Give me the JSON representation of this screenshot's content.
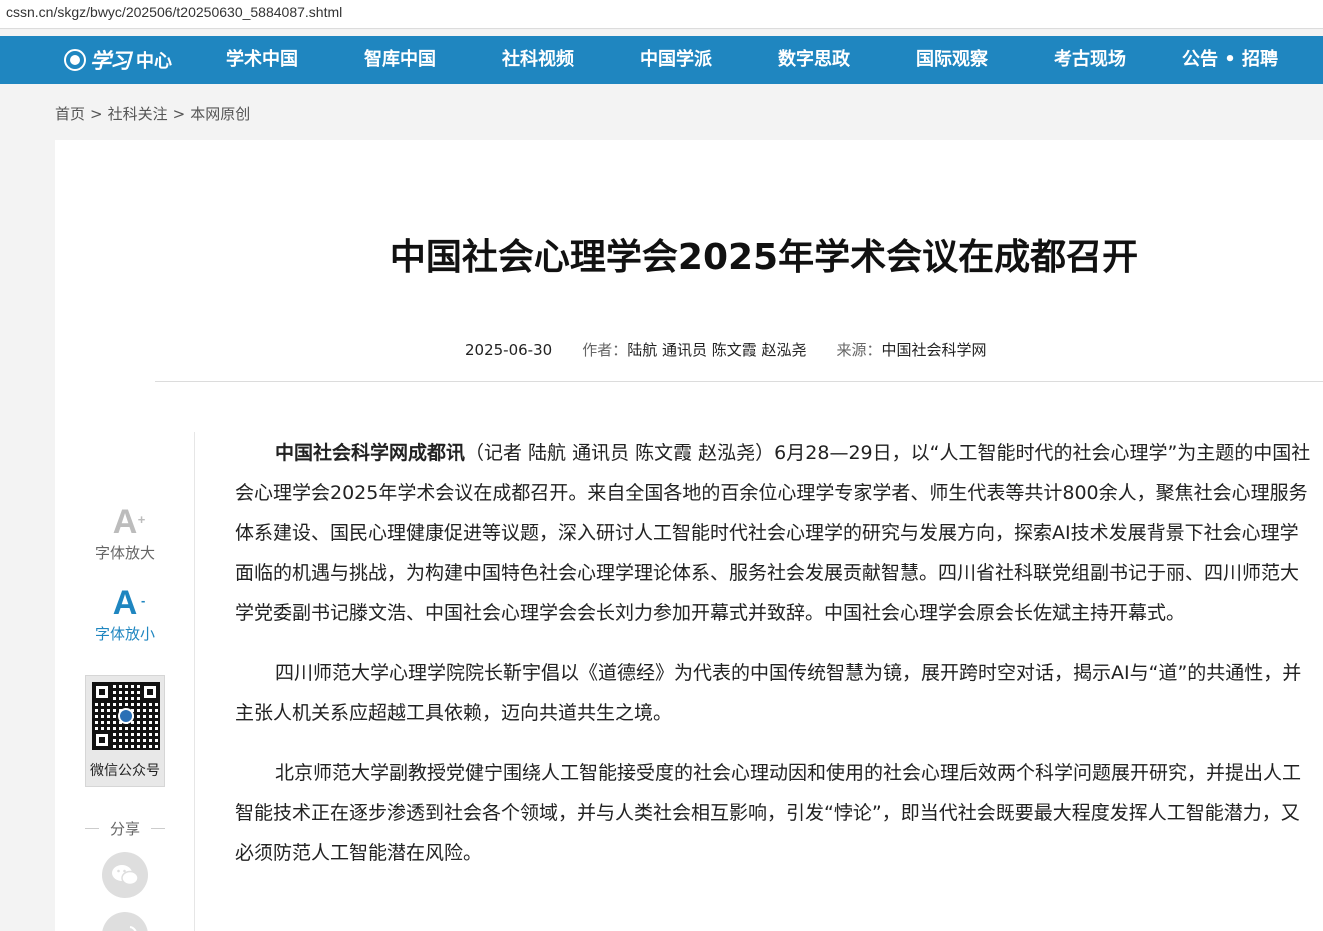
{
  "browser": {
    "url": "cssn.cn/skgz/bwyc/202506/t20250630_5884087.shtml"
  },
  "nav": {
    "logo_script": "学习",
    "logo_center": "中心",
    "items": [
      "学术中国",
      "智库中国",
      "社科视频",
      "中国学派",
      "数字思政",
      "国际观察",
      "考古现场",
      "公告 • 招聘"
    ]
  },
  "breadcrumb": {
    "items": [
      "首页",
      "社科关注",
      "本网原创"
    ],
    "separator": ">"
  },
  "article": {
    "title": "中国社会心理学会2025年学术会议在成都召开",
    "date": "2025-06-30",
    "author_label": "作者：",
    "author": "陆航 通讯员 陈文霞 赵泓尧",
    "source_label": "来源：",
    "source": "中国社会科学网",
    "lead_bold": "中国社会科学网成都讯",
    "paragraphs": [
      "（记者 陆航 通讯员 陈文霞 赵泓尧）6月28—29日，以“人工智能时代的社会心理学”为主题的中国社会心理学会2025年学术会议在成都召开。来自全国各地的百余位心理学专家学者、师生代表等共计800余人，聚焦社会心理服务体系建设、国民心理健康促进等议题，深入研讨人工智能时代社会心理学的研究与发展方向，探索AI技术发展背景下社会心理学面临的机遇与挑战，为构建中国特色社会心理学理论体系、服务社会发展贡献智慧。四川省社科联党组副书记于丽、四川师范大学党委副书记滕文浩、中国社会心理学会会长刘力参加开幕式并致辞。中国社会心理学会原会长佐斌主持开幕式。",
      "四川师范大学心理学院院长靳宇倡以《道德经》为代表的中国传统智慧为镜，展开跨时空对话，揭示AI与“道”的共通性，并主张人机关系应超越工具依赖，迈向共道共生之境。",
      "北京师范大学副教授党健宁围绕人工智能接受度的社会心理动因和使用的社会心理后效两个科学问题展开研究，并提出人工智能技术正在逐步渗透到社会各个领域，并与人类社会相互影响，引发“悖论”，即当代社会既要最大程度发挥人工智能潜力，又必须防范人工智能潜在风险。"
    ]
  },
  "tools": {
    "enlarge_glyph": "A",
    "enlarge_sup": "+",
    "enlarge_label": "字体放大",
    "shrink_glyph": "A",
    "shrink_sup": "-",
    "shrink_label": "字体放小",
    "qr_label": "微信公众号",
    "share_label": "分享",
    "share_icons": [
      "wechat-icon",
      "weibo-icon"
    ]
  },
  "colors": {
    "nav_bg": "#1f86c0",
    "accent": "#1f86c0"
  }
}
